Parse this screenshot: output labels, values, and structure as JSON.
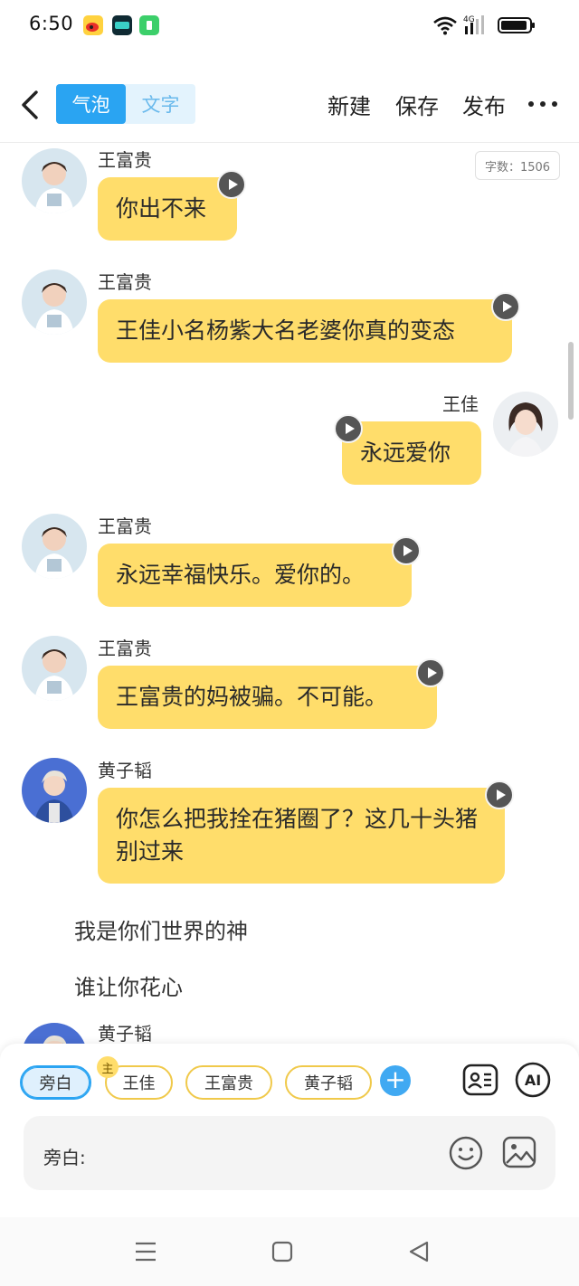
{
  "status_bar": {
    "time": "6:50",
    "network": "4G",
    "battery_level": 0.92
  },
  "header": {
    "back_icon": "chevron-left-icon",
    "mode_tabs": [
      {
        "label": "气泡",
        "active": true
      },
      {
        "label": "文字",
        "active": false
      }
    ],
    "actions": {
      "new": "新建",
      "save": "保存",
      "publish": "发布"
    },
    "more_icon": "more-horizontal-icon"
  },
  "char_count": "字数：1506",
  "messages": [
    {
      "sender": "王富贵",
      "text": "你出不来"
    },
    {
      "sender": "王富贵",
      "text": "王佳小名杨紫大名老婆你真的变态"
    },
    {
      "sender": "王佳",
      "text": "永远爱你"
    },
    {
      "sender": "王富贵",
      "text": "永远幸福快乐。爱你的。"
    },
    {
      "sender": "王富贵",
      "text": "王富贵的妈被骗。不可能。"
    },
    {
      "sender": "黄子韬",
      "text": "你怎么把我拴在猪圈了？这几十头猪别过来"
    }
  ],
  "narrations": [
    "我是你们世界的神",
    "谁让你花心"
  ],
  "partial_sender": "黄子韬",
  "roles": {
    "items": [
      "旁白",
      "王佳",
      "王富贵",
      "黄子韬"
    ],
    "selected": "旁白",
    "host_badge": "主"
  },
  "input": {
    "prefix": "旁白:",
    "placeholder": ""
  },
  "colors": {
    "accent": "#2aa4f2",
    "bubble": "#ffdd6b",
    "chip_border": "#f0c94a"
  },
  "nav": {
    "icons": [
      "menu-icon",
      "home-square-icon",
      "back-triangle-icon"
    ]
  }
}
